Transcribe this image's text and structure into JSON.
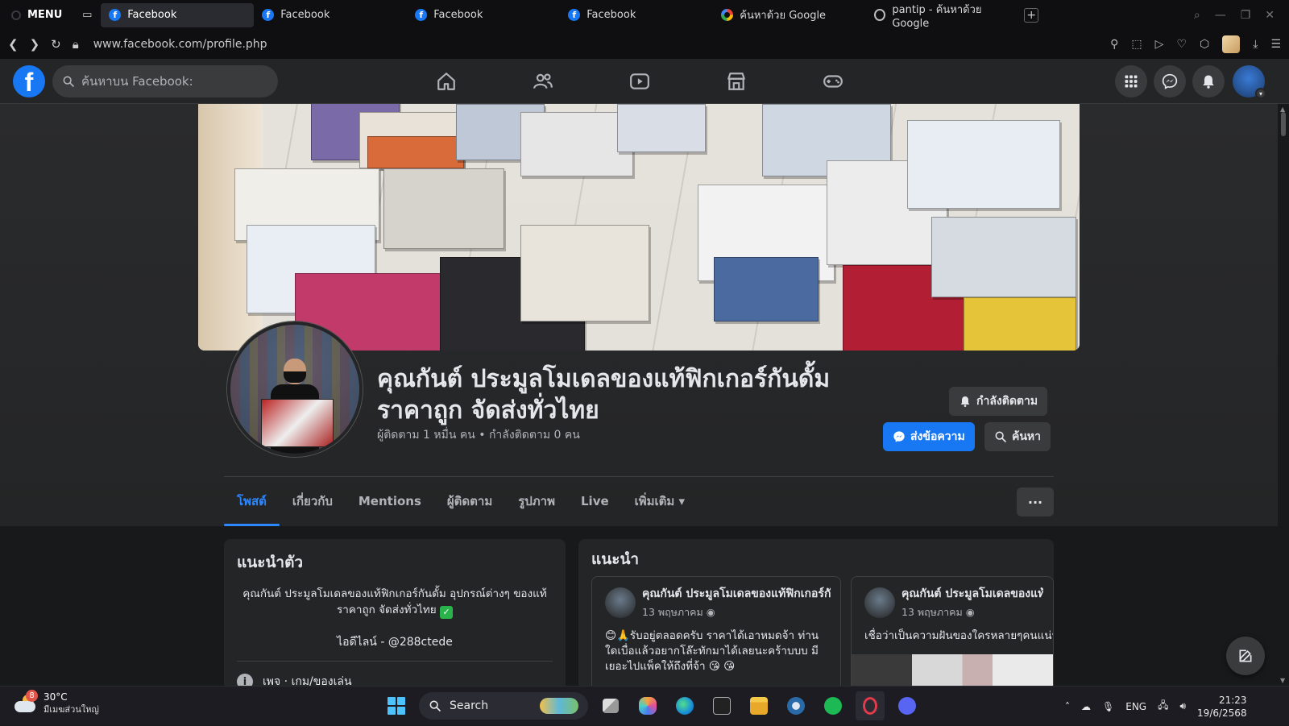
{
  "browser": {
    "menu_label": "MENU",
    "tabs": [
      {
        "title": "Facebook",
        "favicon": "facebook-icon",
        "active": true
      },
      {
        "title": "Facebook",
        "favicon": "facebook-icon",
        "active": false
      },
      {
        "title": "Facebook",
        "favicon": "facebook-icon",
        "active": false
      },
      {
        "title": "Facebook",
        "favicon": "facebook-icon",
        "active": false
      },
      {
        "title": "ค้นหาด้วย Google",
        "favicon": "google-icon",
        "active": false
      },
      {
        "title": "pantip - ค้นหาด้วย Google",
        "favicon": "web-icon",
        "active": false
      }
    ],
    "url": "www.facebook.com/profile.php"
  },
  "fb_nav": {
    "logo": "f",
    "search_placeholder": "ค้นหาบน Facebook:",
    "brand_color": "#1877f2"
  },
  "profile": {
    "title": "คุณกันต์ ประมูลโมเดลของแท้ฟิกเกอร์กันดั้ม ราคาถูก จัดส่งทั่วไทย",
    "meta": "ผู้ติดตาม 1 หมื่น คน • กำลังติดตาม 0 คน",
    "following_btn": "กำลังติดตาม",
    "message_btn": "ส่งข้อความ",
    "search_btn": "ค้นหา"
  },
  "profile_tabs": [
    {
      "label": "โพสต์",
      "active": true
    },
    {
      "label": "เกี่ยวกับ",
      "active": false
    },
    {
      "label": "Mentions",
      "active": false
    },
    {
      "label": "ผู้ติดตาม",
      "active": false
    },
    {
      "label": "รูปภาพ",
      "active": false
    },
    {
      "label": "Live",
      "active": false
    },
    {
      "label": "เพิ่มเติม ▾",
      "active": false
    }
  ],
  "more_label": "···",
  "intro": {
    "heading": "แนะนำตัว",
    "bio": "คุณกันต์ ประมูลโมเดลของแท้ฟิกเกอร์กันดั้ม อุปกรณ์ต่างๆ ของแท้ ราคาถูก จัดส่งทั่วไทย",
    "bio_check": "✓",
    "line_id": "ไอดีไลน์ - @288ctede",
    "category": "เพจ · เกม/ของเล่น"
  },
  "featured": {
    "heading": "แนะนำ",
    "cards": [
      {
        "author": "คุณกันต์ ประมูลโมเดลของแท้ฟิกเกอร์กันดั้ม",
        "date": "13 พฤษภาคม",
        "text": "😊🙏รับอยู่ตลอดครับ ราคาได้เอาหมดจ้า ท่านใดเบื่อแล้วอยากโล๊ะทักมาได้เลยนะคร้าบบบ มีเยอะไปแพ็คให้ถึงที่จ้า 😘 😘"
      },
      {
        "author": "คุณกันต์ ประมูลโมเดลของแท้ฟิกเกอร์กันดั้ม",
        "date": "13 พฤษภาคม",
        "text": "เชื่อว่าเป็นความฝันของใครหลายๆคนแน่นอน"
      }
    ]
  },
  "taskbar": {
    "weather_temp": "30°C",
    "weather_desc": "มีเมฆส่วนใหญ่",
    "weather_badge": "8",
    "search_label": "Search",
    "lang": "ENG",
    "time": "21:23",
    "date": "19/6/2568"
  }
}
